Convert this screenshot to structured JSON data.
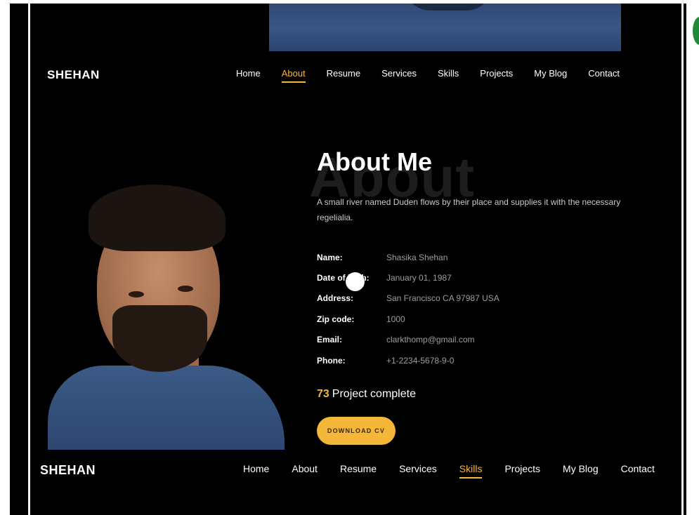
{
  "brand": "SHEHAN",
  "nav_top": {
    "items": [
      "Home",
      "About",
      "Resume",
      "Services",
      "Skills",
      "Projects",
      "My Blog",
      "Contact"
    ],
    "active": "About"
  },
  "nav_bottom": {
    "items": [
      "Home",
      "About",
      "Resume",
      "Services",
      "Skills",
      "Projects",
      "My Blog",
      "Contact"
    ],
    "active": "Skills"
  },
  "about": {
    "ghost_text": "About",
    "title": "About Me",
    "description": "A small river named Duden flows by their place and supplies it with the necessary regelialia."
  },
  "info": [
    {
      "label": "Name:",
      "value": "Shasika Shehan"
    },
    {
      "label": "Date of birth:",
      "value": "January 01, 1987"
    },
    {
      "label": "Address:",
      "value": "San Francisco CA 97987 USA"
    },
    {
      "label": "Zip code:",
      "value": "1000"
    },
    {
      "label": "Email:",
      "value": "clarkthomp@gmail.com"
    },
    {
      "label": "Phone:",
      "value": "+1-2234-5678-9-0"
    }
  ],
  "projects": {
    "count": "73",
    "label": "Project complete"
  },
  "download_button": "DOWNLOAD CV",
  "colors": {
    "accent": "#f4b73a",
    "background": "#000000"
  }
}
